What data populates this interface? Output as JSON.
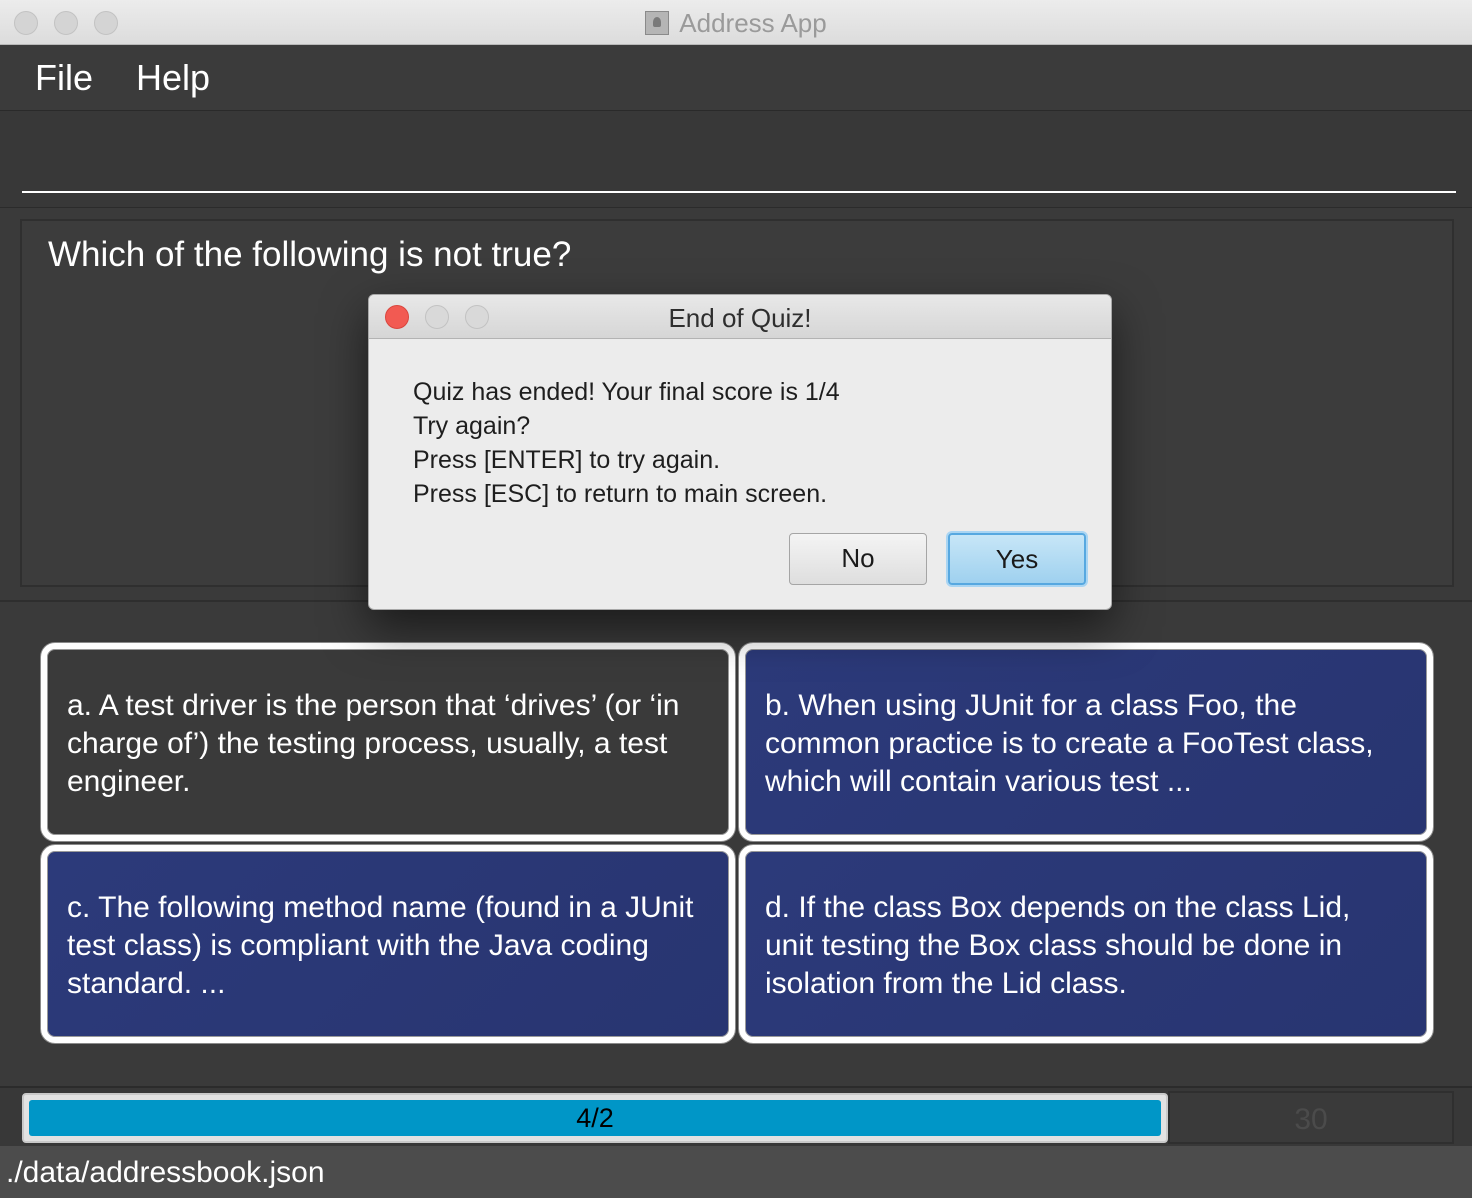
{
  "window": {
    "title": "Address App"
  },
  "menu": {
    "items": [
      "File",
      "Help"
    ]
  },
  "command": {
    "value": ""
  },
  "question": {
    "text": "Which of the following is not true?"
  },
  "options": [
    {
      "text": "a. A test driver is the person that ‘drives’ (or ‘in charge of’) the testing process, usually, a test engineer.",
      "style": "dark"
    },
    {
      "text": "b. When using JUnit for a class Foo, the common practice is to create a FooTest class, which will contain various test ...",
      "style": "blue"
    },
    {
      "text": "c. The following method name (found in a JUnit test class) is compliant with the Java coding standard. ...",
      "style": "blue"
    },
    {
      "text": "d. If the class Box depends on the class Lid, unit testing the Box class should be done in isolation from the Lid class.",
      "style": "blue"
    }
  ],
  "progress": {
    "label": "4/2",
    "fraction": 1.0
  },
  "timer": {
    "value": "30"
  },
  "status": {
    "path": "./data/addressbook.json"
  },
  "dialog": {
    "title": "End of Quiz!",
    "lines": [
      "Quiz has ended! Your final score is 1/4",
      "Try again?",
      "Press [ENTER] to try again.",
      "Press [ESC] to return to main screen."
    ],
    "no_label": "No",
    "yes_label": "Yes"
  },
  "colors": {
    "option_blue": "#2c3a7a",
    "progress_fill": "#0096c7",
    "close_button": "#f25a52"
  }
}
